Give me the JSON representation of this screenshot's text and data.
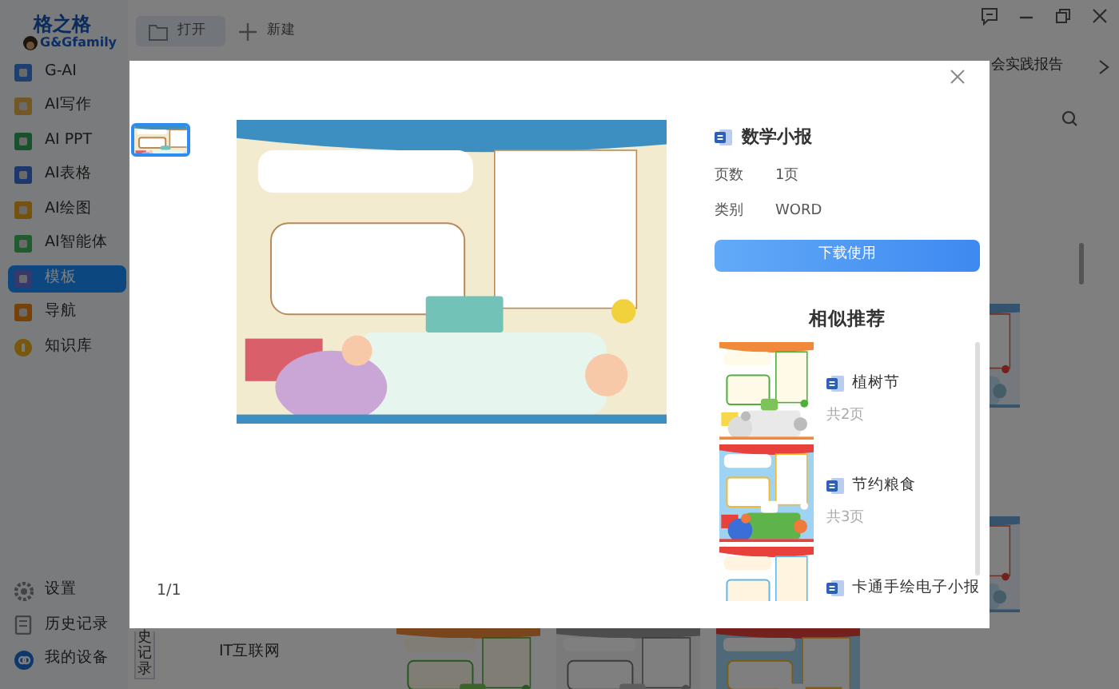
{
  "logo": {
    "title": "格之格",
    "subtitle": "G&Gfamily"
  },
  "sidebar": {
    "items": [
      {
        "label": "G-AI",
        "selected": false,
        "color": "#1e4070"
      },
      {
        "label": "AI写作",
        "selected": false,
        "color": "#735825"
      },
      {
        "label": "AI PPT",
        "selected": false,
        "color": "#17522d"
      },
      {
        "label": "AI表格",
        "selected": false,
        "color": "#1d386c"
      },
      {
        "label": "AI绘图",
        "selected": false,
        "color": "#75520e"
      },
      {
        "label": "AI智能体",
        "selected": false,
        "color": "#205c2d"
      },
      {
        "label": "模板",
        "selected": true,
        "color": "#35396c"
      },
      {
        "label": "导航",
        "selected": false,
        "color": "#774209"
      },
      {
        "label": "知识库",
        "selected": false,
        "color": "#77580d"
      }
    ],
    "bottom_items": [
      {
        "label": "设置",
        "kind": "gear"
      },
      {
        "label": "历史记录",
        "kind": "document"
      },
      {
        "label": "我的设备",
        "kind": "device"
      }
    ]
  },
  "toolbar": {
    "buttons": [
      {
        "label": "打开",
        "selected": true,
        "kind": "folder"
      },
      {
        "label": "新建",
        "selected": false,
        "kind": "plus"
      }
    ]
  },
  "tab_strip": {
    "last_tab": "会实践报告"
  },
  "side_tab": "史记录",
  "categories": [
    "IT互联网"
  ],
  "dialog": {
    "thumbnails": [
      {
        "selected": true
      }
    ],
    "page_counter": "1/1",
    "title": "数学小报",
    "details": [
      {
        "label": "页数",
        "value": "1页"
      },
      {
        "label": "类别",
        "value": "WORD"
      }
    ],
    "button": "下载使用",
    "similar_heading": "相似推荐",
    "similar": [
      {
        "title": "植树节",
        "pages": "共2页",
        "kind": "trees"
      },
      {
        "title": "节约粮食",
        "pages": "共3页",
        "kind": "food"
      },
      {
        "title": "卡通手绘电子小报",
        "kind": "cartoon"
      }
    ]
  }
}
